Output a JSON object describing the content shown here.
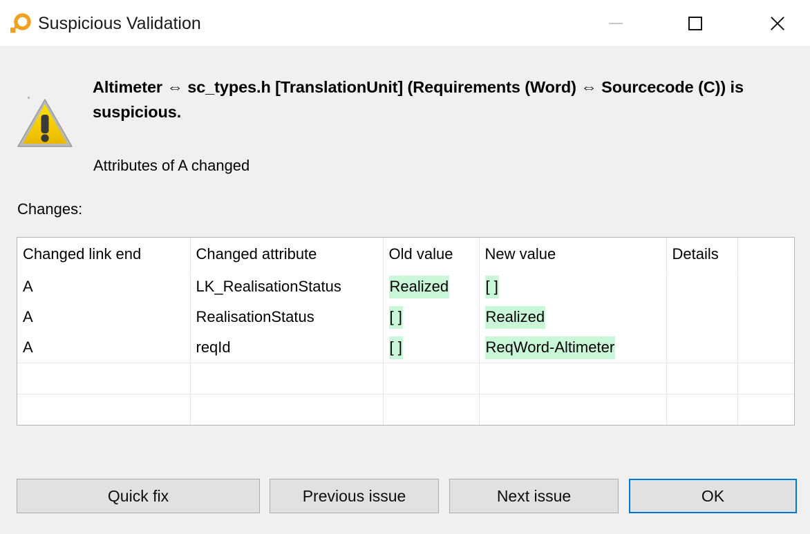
{
  "window": {
    "title": "Suspicious Validation",
    "icon": "app-ring-icon",
    "controls": {
      "minimize": "minimize-icon",
      "maximize": "maximize-icon",
      "close": "close-icon"
    }
  },
  "dialog": {
    "icon": "warning-triangle-icon",
    "heading": "Altimeter ⇔ sc_types.h [TranslationUnit] (Requirements (Word)  ⇔ Sourcecode (C)) is suspicious.",
    "subtext": "Attributes of A changed",
    "changes_label": "Changes:"
  },
  "table": {
    "columns": [
      "Changed link end",
      "Changed attribute",
      "Old value",
      "New value",
      "Details",
      ""
    ],
    "rows": [
      {
        "changed_link_end": "A",
        "changed_attribute": "LK_RealisationStatus",
        "old_value": "Realized",
        "old_value_highlighted": true,
        "new_value": "[ ]",
        "new_value_highlighted": true,
        "details": ""
      },
      {
        "changed_link_end": "A",
        "changed_attribute": "RealisationStatus",
        "old_value": "[ ]",
        "old_value_highlighted": true,
        "new_value": "Realized",
        "new_value_highlighted": true,
        "details": ""
      },
      {
        "changed_link_end": "A",
        "changed_attribute": "reqId",
        "old_value": "[ ]",
        "old_value_highlighted": true,
        "new_value": "ReqWord-Altimeter",
        "new_value_highlighted": true,
        "details": ""
      }
    ],
    "empty_row_count": 2,
    "highlight_color": "#c9f7d7"
  },
  "buttons": {
    "quick_fix": "Quick fix",
    "previous_issue": "Previous issue",
    "next_issue": "Next issue",
    "ok": "OK",
    "default_button_accent": "#0078d7"
  }
}
